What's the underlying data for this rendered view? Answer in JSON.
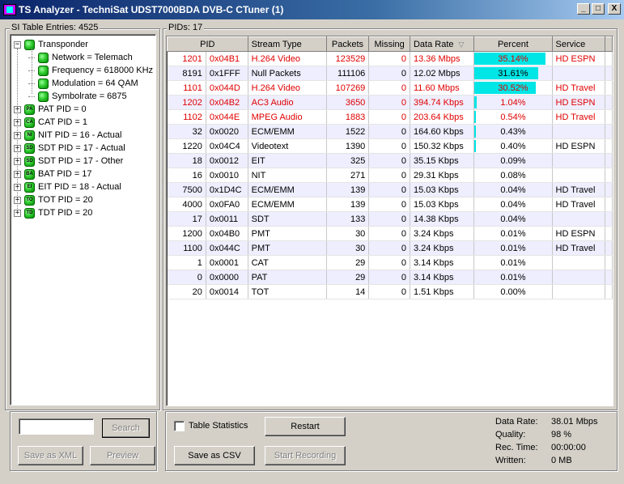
{
  "window": {
    "title": "TS Analyzer - TechniSat UDST7000BDA DVB-C CTuner (1)",
    "minimize_glyph": "_",
    "maximize_glyph": "□",
    "close_glyph": "X"
  },
  "si_panel": {
    "label": "SI Table Entries: 4525",
    "tree": [
      {
        "label": "Transponder",
        "icon": "",
        "level": 0,
        "expander": "−"
      },
      {
        "label": "Network = Telemach",
        "icon": "",
        "level": 1,
        "expander": ""
      },
      {
        "label": "Frequency = 618000 KHz",
        "icon": "",
        "level": 1,
        "expander": ""
      },
      {
        "label": "Modulation = 64 QAM",
        "icon": "",
        "level": 1,
        "expander": ""
      },
      {
        "label": "Symbolrate = 6875",
        "icon": "",
        "level": 1,
        "expander": ""
      },
      {
        "label": "PAT PID = 0",
        "icon": "PA",
        "level": 0,
        "expander": "+"
      },
      {
        "label": "CAT PID = 1",
        "icon": "CA",
        "level": 0,
        "expander": "+"
      },
      {
        "label": "NIT PID = 16 - Actual",
        "icon": "NI",
        "level": 0,
        "expander": "+"
      },
      {
        "label": "SDT PID = 17 - Actual",
        "icon": "SD",
        "level": 0,
        "expander": "+"
      },
      {
        "label": "SDT PID = 17 - Other",
        "icon": "SD",
        "level": 0,
        "expander": "+"
      },
      {
        "label": "BAT PID = 17",
        "icon": "BA",
        "level": 0,
        "expander": "+"
      },
      {
        "label": "EIT PID = 18 - Actual",
        "icon": "EI",
        "level": 0,
        "expander": "+"
      },
      {
        "label": "TOT PID = 20",
        "icon": "TO",
        "level": 0,
        "expander": "+"
      },
      {
        "label": "TDT PID = 20",
        "icon": "TD",
        "level": 0,
        "expander": "+"
      }
    ],
    "search_value": "",
    "search_button": "Search",
    "save_xml_button": "Save as XML",
    "preview_button": "Preview"
  },
  "pids_panel": {
    "label": "PIDs: 17",
    "columns": [
      "PID",
      "Stream Type",
      "Packets",
      "Missing",
      "Data Rate",
      "Percent",
      "Service"
    ],
    "sort_indicator": "▽",
    "rows": [
      {
        "pid": "1201",
        "hex": "0x04B1",
        "type": "H.264 Video",
        "packets": "123529",
        "missing": "0",
        "rate": "13.36 Mbps",
        "percent": "35.14%",
        "bar": 0.3514,
        "service": "HD ESPN",
        "red": true
      },
      {
        "pid": "8191",
        "hex": "0x1FFF",
        "type": "Null Packets",
        "packets": "111106",
        "missing": "0",
        "rate": "12.02 Mbps",
        "percent": "31.61%",
        "bar": 0.3161,
        "service": "",
        "red": false
      },
      {
        "pid": "1101",
        "hex": "0x044D",
        "type": "H.264 Video",
        "packets": "107269",
        "missing": "0",
        "rate": "11.60 Mbps",
        "percent": "30.52%",
        "bar": 0.3052,
        "service": "HD Travel",
        "red": true
      },
      {
        "pid": "1202",
        "hex": "0x04B2",
        "type": "AC3 Audio",
        "packets": "3650",
        "missing": "0",
        "rate": "394.74 Kbps",
        "percent": "1.04%",
        "bar": 0.0104,
        "service": "HD ESPN",
        "red": true
      },
      {
        "pid": "1102",
        "hex": "0x044E",
        "type": "MPEG Audio",
        "packets": "1883",
        "missing": "0",
        "rate": "203.64 Kbps",
        "percent": "0.54%",
        "bar": 0.0054,
        "service": "HD Travel",
        "red": true
      },
      {
        "pid": "32",
        "hex": "0x0020",
        "type": "ECM/EMM",
        "packets": "1522",
        "missing": "0",
        "rate": "164.60 Kbps",
        "percent": "0.43%",
        "bar": 0.0043,
        "service": "",
        "red": false
      },
      {
        "pid": "1220",
        "hex": "0x04C4",
        "type": "Videotext",
        "packets": "1390",
        "missing": "0",
        "rate": "150.32 Kbps",
        "percent": "0.40%",
        "bar": 0.004,
        "service": "HD ESPN",
        "red": false
      },
      {
        "pid": "18",
        "hex": "0x0012",
        "type": "EIT",
        "packets": "325",
        "missing": "0",
        "rate": "35.15 Kbps",
        "percent": "0.09%",
        "bar": 0,
        "service": "",
        "red": false
      },
      {
        "pid": "16",
        "hex": "0x0010",
        "type": "NIT",
        "packets": "271",
        "missing": "0",
        "rate": "29.31 Kbps",
        "percent": "0.08%",
        "bar": 0,
        "service": "",
        "red": false
      },
      {
        "pid": "7500",
        "hex": "0x1D4C",
        "type": "ECM/EMM",
        "packets": "139",
        "missing": "0",
        "rate": "15.03 Kbps",
        "percent": "0.04%",
        "bar": 0,
        "service": "HD Travel",
        "red": false
      },
      {
        "pid": "4000",
        "hex": "0x0FA0",
        "type": "ECM/EMM",
        "packets": "139",
        "missing": "0",
        "rate": "15.03 Kbps",
        "percent": "0.04%",
        "bar": 0,
        "service": "HD Travel",
        "red": false
      },
      {
        "pid": "17",
        "hex": "0x0011",
        "type": "SDT",
        "packets": "133",
        "missing": "0",
        "rate": "14.38 Kbps",
        "percent": "0.04%",
        "bar": 0,
        "service": "",
        "red": false
      },
      {
        "pid": "1200",
        "hex": "0x04B0",
        "type": "PMT",
        "packets": "30",
        "missing": "0",
        "rate": "3.24 Kbps",
        "percent": "0.01%",
        "bar": 0,
        "service": "HD ESPN",
        "red": false
      },
      {
        "pid": "1100",
        "hex": "0x044C",
        "type": "PMT",
        "packets": "30",
        "missing": "0",
        "rate": "3.24 Kbps",
        "percent": "0.01%",
        "bar": 0,
        "service": "HD Travel",
        "red": false
      },
      {
        "pid": "1",
        "hex": "0x0001",
        "type": "CAT",
        "packets": "29",
        "missing": "0",
        "rate": "3.14 Kbps",
        "percent": "0.01%",
        "bar": 0,
        "service": "",
        "red": false
      },
      {
        "pid": "0",
        "hex": "0x0000",
        "type": "PAT",
        "packets": "29",
        "missing": "0",
        "rate": "3.14 Kbps",
        "percent": "0.01%",
        "bar": 0,
        "service": "",
        "red": false
      },
      {
        "pid": "20",
        "hex": "0x0014",
        "type": "TOT",
        "packets": "14",
        "missing": "0",
        "rate": "1.51 Kbps",
        "percent": "0.00%",
        "bar": 0,
        "service": "",
        "red": false
      }
    ]
  },
  "bottom": {
    "table_stats_label": "Table Statistics",
    "restart_button": "Restart",
    "save_csv_button": "Save as CSV",
    "start_recording_button": "Start Recording",
    "stats": [
      {
        "label": "Data Rate:",
        "value": "38.01 Mbps"
      },
      {
        "label": "Quality:",
        "value": "98 %"
      },
      {
        "label": "Rec. Time:",
        "value": "00:00:00"
      },
      {
        "label": "Written:",
        "value": "0 MB"
      }
    ]
  },
  "colors": {
    "percent_bar": "#00e5e5",
    "highlight_text": "#e00000",
    "alt_row": "#eeeeff"
  }
}
